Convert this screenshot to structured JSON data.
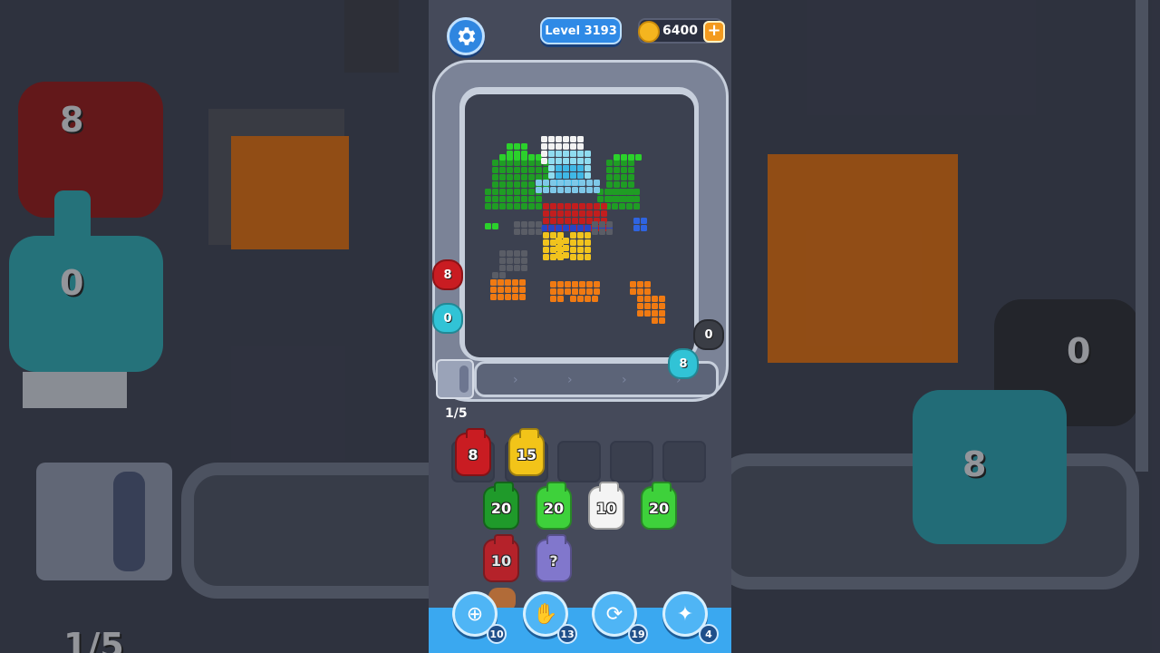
{
  "header": {
    "level_label": "Level 3193",
    "coins": "6400",
    "coin_plus": "+",
    "settings_icon": "gear-icon"
  },
  "board": {
    "page_counter": "1/5"
  },
  "belt_creatures": [
    {
      "color": "#c91c22",
      "value": "8"
    },
    {
      "color": "#31c3d6",
      "value": "0"
    },
    {
      "color": "#3a3d45",
      "value": "0"
    },
    {
      "color": "#31c3d6",
      "value": "8"
    }
  ],
  "slot_jars": [
    {
      "color": "#c91c22",
      "value": "8"
    },
    {
      "color": "#f2c419",
      "value": "15"
    }
  ],
  "queue_jars": [
    {
      "color": "#1f9a2a",
      "value": "20"
    },
    {
      "color": "#3ed13b",
      "value": "20"
    },
    {
      "color": "#f4f4f4",
      "value": "10"
    },
    {
      "color": "#3ed13b",
      "value": "20"
    },
    {
      "color": "#c91c22",
      "value": "10"
    },
    {
      "color": "#8c7fe0",
      "value": "?"
    }
  ],
  "boosters": [
    {
      "icon": "add-slot-icon",
      "count": "10"
    },
    {
      "icon": "hand-icon",
      "count": "13"
    },
    {
      "icon": "shuffle-icon",
      "count": "19"
    },
    {
      "icon": "magic-icon",
      "count": "4"
    }
  ],
  "background": {
    "left_top_value": "8",
    "left_mid_value": "0",
    "left_bottom_text": "1/5",
    "right_top_value": "0",
    "right_mid_value": "8"
  }
}
